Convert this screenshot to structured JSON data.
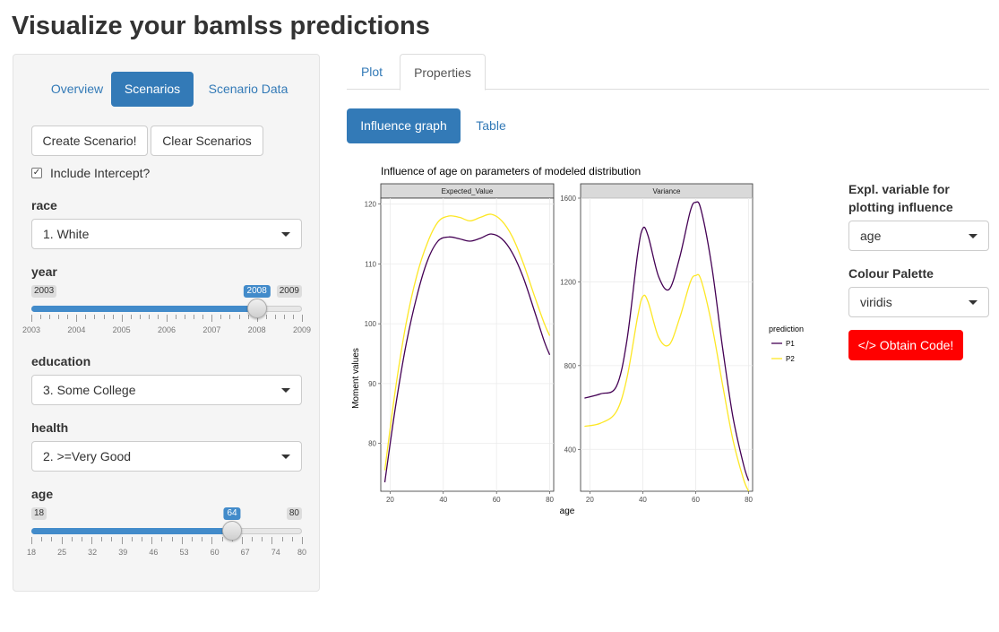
{
  "header": {
    "title": "Visualize your bamlss predictions"
  },
  "sidebar": {
    "pills": [
      {
        "label": "Overview",
        "active": false
      },
      {
        "label": "Scenarios",
        "active": true
      },
      {
        "label": "Scenario Data",
        "active": false
      }
    ],
    "create_button": "Create Scenario!",
    "clear_button": "Clear Scenarios",
    "intercept": {
      "label": "Include Intercept?",
      "checked": true
    },
    "race": {
      "label": "race",
      "value": "1. White"
    },
    "year": {
      "label": "year",
      "min": 2003,
      "max": 2009,
      "value": 2008,
      "min_label": "2003",
      "max_label": "2009",
      "value_label": "2008",
      "ticks": [
        "2003",
        "2004",
        "2005",
        "2006",
        "2007",
        "2008",
        "2009"
      ]
    },
    "education": {
      "label": "education",
      "value": "3. Some College"
    },
    "health": {
      "label": "health",
      "value": "2. >=Very Good"
    },
    "age": {
      "label": "age",
      "min": 18,
      "max": 80,
      "value": 64,
      "min_label": "18",
      "max_label": "80",
      "value_label": "64",
      "ticks": [
        "18",
        "25",
        "32",
        "39",
        "46",
        "53",
        "60",
        "67",
        "74",
        "80"
      ]
    }
  },
  "main": {
    "tabs": [
      {
        "label": "Plot",
        "active": false
      },
      {
        "label": "Properties",
        "active": true
      }
    ],
    "subtabs": [
      {
        "label": "Influence graph",
        "active": true
      },
      {
        "label": "Table",
        "active": false
      }
    ]
  },
  "controls": {
    "expl_label_line1": "Expl. variable for",
    "expl_label_line2": "plotting influence",
    "expl_value": "age",
    "palette_label": "Colour Palette",
    "palette_value": "viridis",
    "code_button": "</> Obtain Code!"
  },
  "colors": {
    "p1": "#440154",
    "p2": "#fde725",
    "accent": "#337ab7",
    "code_button": "#ff0000"
  },
  "chart_data": {
    "type": "line",
    "title": "Influence of age on parameters of modeled distribution",
    "xlabel": "age",
    "ylabel": "Moment values",
    "legend": {
      "title": "prediction",
      "entries": [
        "P1",
        "P2"
      ],
      "placement": "right"
    },
    "grid": true,
    "panels": [
      {
        "name": "Expected_Value",
        "xlim": [
          16.5,
          81.5
        ],
        "ylim": [
          72,
          121
        ],
        "xticks": [
          "20",
          "40",
          "60",
          "80"
        ],
        "yticks": [
          "80",
          "90",
          "100",
          "110",
          "120"
        ],
        "series": [
          {
            "name": "P1",
            "x": [
              18,
              22,
              26,
              30,
              34,
              38,
              42,
              46,
              50,
              54,
              58,
              62,
              66,
              70,
              74,
              78,
              80
            ],
            "y": [
              73.5,
              86,
              96.5,
              104.5,
              110.5,
              113.8,
              114.5,
              114.2,
              113.8,
              114.3,
              115,
              114.2,
              111.8,
              107.8,
              102.5,
              97,
              94.8
            ]
          },
          {
            "name": "P2",
            "x": [
              18,
              22,
              26,
              30,
              34,
              38,
              42,
              46,
              50,
              54,
              58,
              62,
              66,
              70,
              74,
              78,
              80
            ],
            "y": [
              75.5,
              89,
              100,
              108,
              113.5,
              117,
              118,
              117.8,
              117.2,
              117.8,
              118.3,
              117.2,
              114.5,
              110.2,
              105,
              100,
              98
            ]
          }
        ]
      },
      {
        "name": "Variance",
        "xlim": [
          16.5,
          81.5
        ],
        "ylim": [
          200,
          1600
        ],
        "xticks": [
          "20",
          "40",
          "60",
          "80"
        ],
        "yticks": [
          "400",
          "800",
          "1200",
          "1600"
        ],
        "series": [
          {
            "name": "P1",
            "x": [
              18,
              24,
              30,
              34,
              38,
              40,
              42,
              46,
              50,
              54,
              58,
              60,
              62,
              66,
              70,
              74,
              78,
              80
            ],
            "y": [
              645,
              665,
              700,
              920,
              1330,
              1455,
              1420,
              1225,
              1165,
              1320,
              1540,
              1580,
              1545,
              1280,
              900,
              560,
              330,
              250
            ]
          },
          {
            "name": "P2",
            "x": [
              18,
              24,
              30,
              34,
              38,
              40,
              42,
              46,
              50,
              54,
              58,
              60,
              62,
              66,
              70,
              74,
              78,
              80
            ],
            "y": [
              510,
              525,
              580,
              740,
              1030,
              1130,
              1105,
              935,
              900,
              1030,
              1200,
              1230,
              1210,
              1000,
              720,
              450,
              260,
              200
            ]
          }
        ]
      }
    ]
  }
}
